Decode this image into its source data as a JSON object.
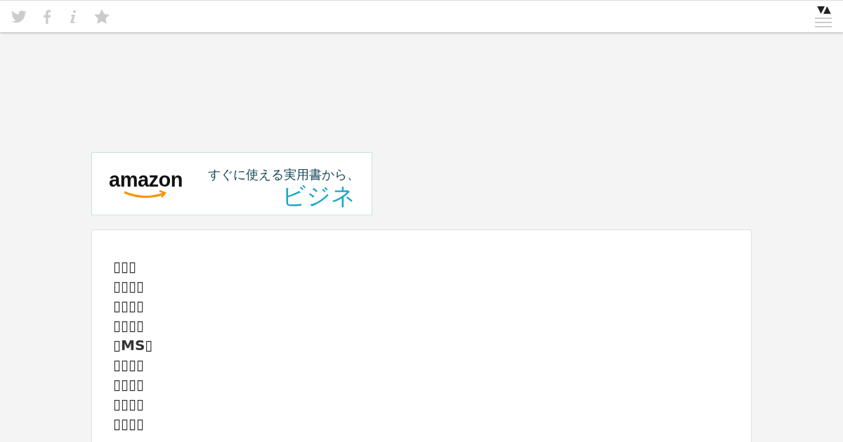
{
  "top_bar": {
    "sort_toggle": "▼▲"
  },
  "ad_banner": {
    "logo": "amazon",
    "headline": "すぐに使える実用書から、",
    "highlight": "ビジネ"
  },
  "article": {
    "lines": [
      "▯▯▯",
      "▯▯▯▯",
      "▯▯▯▯",
      "▯▯▯▯",
      "▯MS▯",
      "▯▯▯▯",
      "▯▯▯▯",
      "▯▯▯▯",
      "▯▯▯▯"
    ]
  }
}
